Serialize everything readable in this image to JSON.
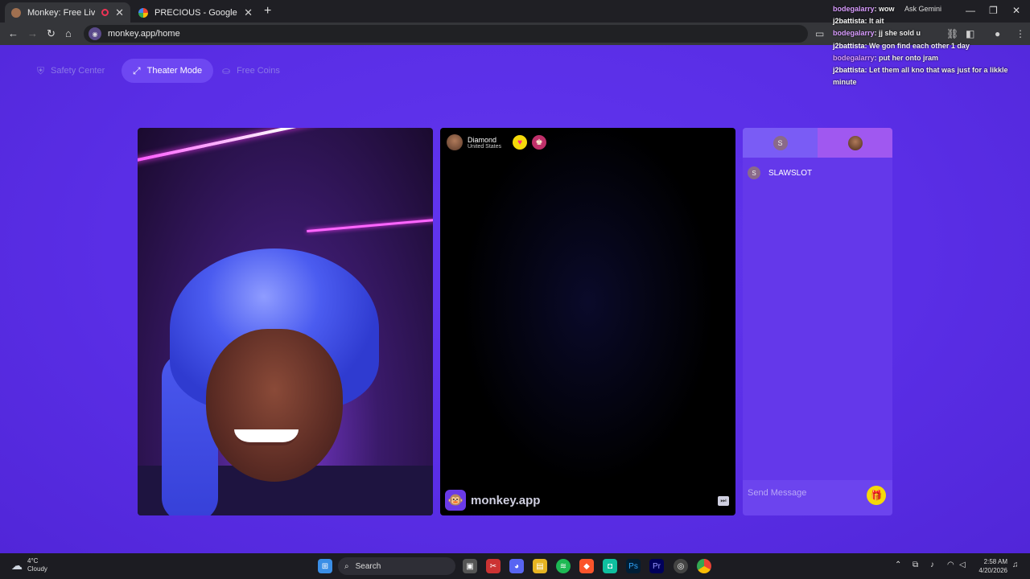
{
  "browser": {
    "tabs": [
      {
        "title": "Monkey: Free Live Video Ch",
        "active": true
      },
      {
        "title": "PRECIOUS - Google Search",
        "active": false
      }
    ],
    "new_tab": "+",
    "url": "monkey.app/home",
    "ask_gemini": "Ask Gemini"
  },
  "toolbar": {
    "safety_center": "Safety Center",
    "theater_mode": "Theater Mode",
    "free_coins": "Free Coins"
  },
  "peer": {
    "name": "Diamond",
    "country": "United States"
  },
  "brand": {
    "word": "monkey.app"
  },
  "chat": {
    "tab_initial": "S",
    "user_initial": "S",
    "username": "SLAWSLOT",
    "placeholder": "Send Message"
  },
  "overlay_chat": [
    {
      "user": "bodegalarry",
      "msg": "wow"
    },
    {
      "user": "j2battista",
      "msg": "It ait"
    },
    {
      "user": "bodegalarry",
      "msg": "jj she sold u"
    },
    {
      "user": "j2battista",
      "msg": "We gon find each other 1 day"
    },
    {
      "user": "bodegalarry",
      "msg": "put her onto jram"
    },
    {
      "user": "j2battista",
      "msg": "Let them all kno that was just for a likkle minute"
    }
  ],
  "taskbar": {
    "temp": "4°C",
    "condition": "Cloudy",
    "search": "Search",
    "time": "2:58 AM",
    "date": "4/20/2026"
  },
  "colors": {
    "page_bg": "#5a2ee6",
    "accent_yellow": "#f5d90a"
  }
}
